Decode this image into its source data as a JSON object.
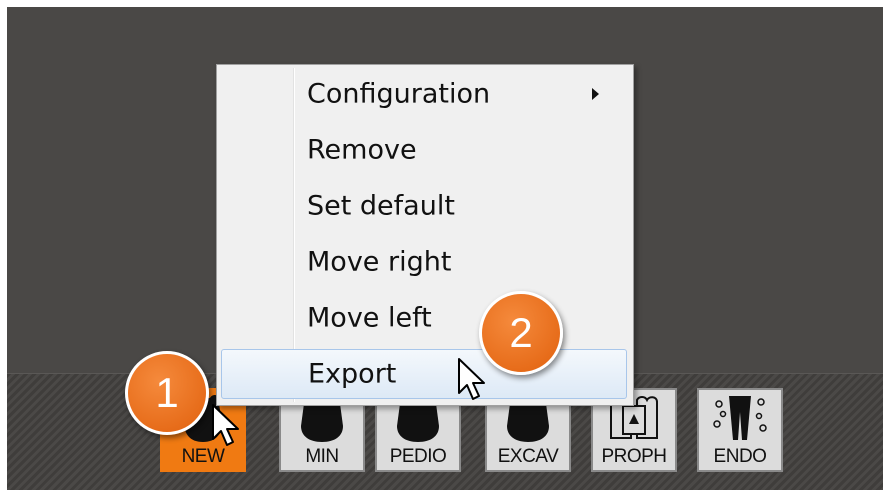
{
  "context_menu": {
    "items": [
      {
        "label": "Configuration",
        "has_submenu": true
      },
      {
        "label": "Remove"
      },
      {
        "label": "Set default"
      },
      {
        "label": "Move right"
      },
      {
        "label": "Move left"
      },
      {
        "label": "Export",
        "hovered": true
      }
    ]
  },
  "toolbar": {
    "tools": [
      {
        "label": "NEW",
        "active": true
      },
      {
        "label": "MIN"
      },
      {
        "label": "PEDIO"
      },
      {
        "label": "EXCAV"
      },
      {
        "label": "PROPH"
      },
      {
        "label": "ENDO"
      }
    ]
  },
  "callouts": {
    "step1": "1",
    "step2": "2"
  },
  "colors": {
    "accent": "#e8701a",
    "background": "#4a4846",
    "menu": "#f0f0f0",
    "hover": "#dde9f6"
  }
}
